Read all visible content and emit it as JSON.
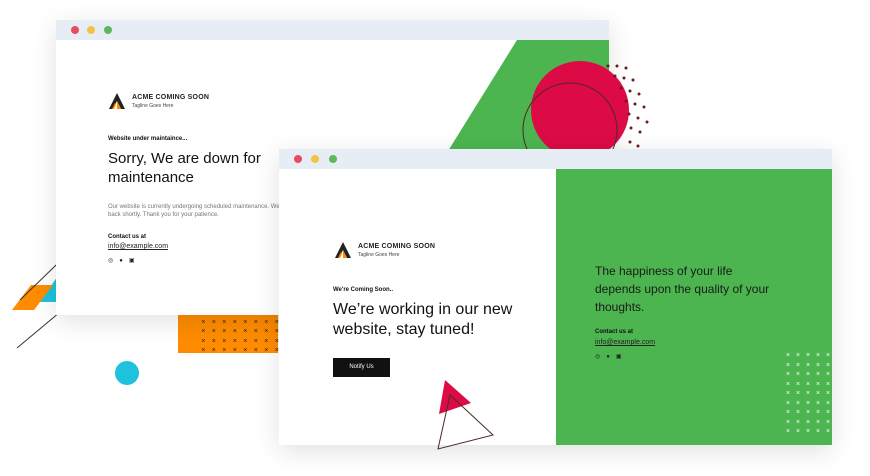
{
  "brand": {
    "name": "ACME COMING SOON",
    "tagline": "Tagline Goes Here"
  },
  "back_window": {
    "eyebrow": "Website under maintaince...",
    "heading_line1": "Sorry, We are down for",
    "heading_line2": "maintenance",
    "body_line1": "Our website is currently undergoing scheduled maintenance. We S",
    "body_line2": "back shortly. Thank you for your patience.",
    "contact_label": "Contact us at",
    "email": "info@example.com"
  },
  "front_window": {
    "eyebrow": "We're Coming Soon..",
    "heading_line1": "We’re working in our new",
    "heading_line2": "website, stay tuned!",
    "notify_button": "Notify Us",
    "quote_line1": "The happiness of your life",
    "quote_line2": "depends upon the quality of your",
    "quote_line3": "thoughts.",
    "contact_label": "Contact us at",
    "email": "info@example.com"
  },
  "social_icons": [
    "instagram-icon",
    "facebook-icon",
    "linkedin-icon"
  ],
  "colors": {
    "green": "#4cb550",
    "crimson": "#dc0a45",
    "orange": "#ff8c00",
    "cyan": "#1fc2dd",
    "dark_button": "#111111",
    "titlebar": "#e6edf5"
  }
}
